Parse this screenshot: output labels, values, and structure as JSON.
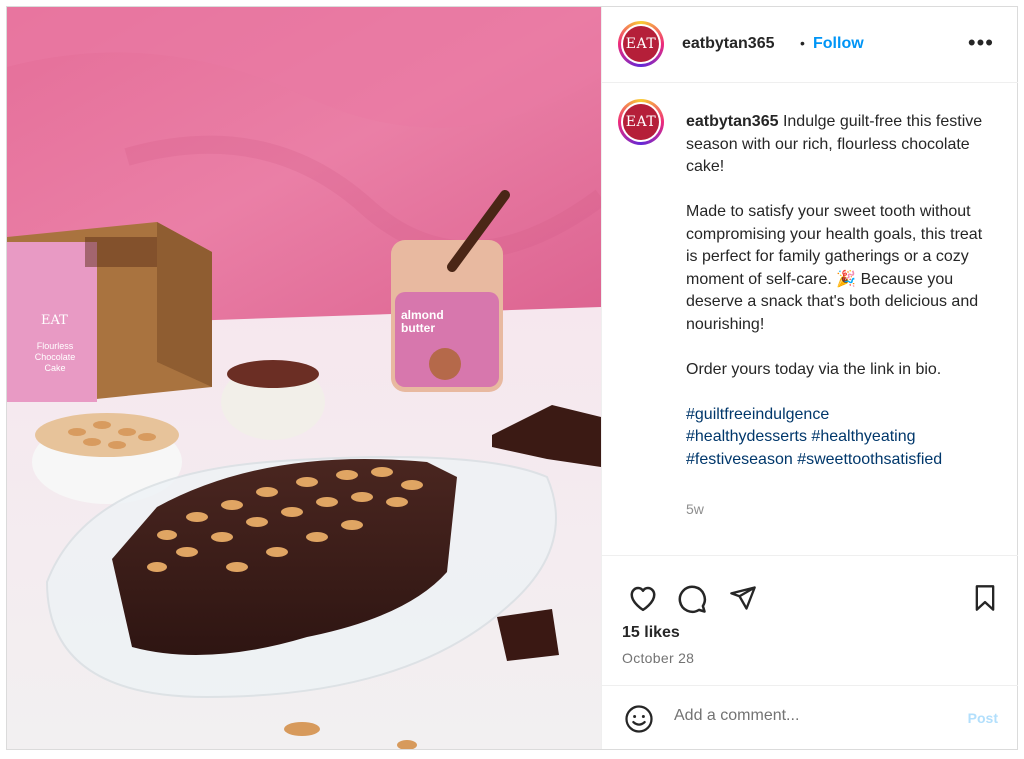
{
  "colors": {
    "accent": "#0095f6",
    "hashtag": "#00376b",
    "brand": "#b51f39"
  },
  "post": {
    "avatar_logo_text": "EAT",
    "username": "eatbytan365",
    "separator": "•",
    "follow_label": "Follow",
    "more_icon": "more-options-icon",
    "caption": {
      "line1": "Indulge guilt-free this festive season with our rich, flourless chocolate cake!",
      "para2": "Made to satisfy your sweet tooth without compromising your health goals, this treat is perfect for family gatherings or a cozy moment of self-care. 🎉 Because you deserve a snack that's both delicious and nourishing!",
      "para3": "Order yours today via the link in bio.",
      "hashtags": [
        "#guiltfreeindulgence",
        "#healthydesserts",
        "#healthyeating",
        "#festiveseason",
        "#sweettoothsatisfied"
      ]
    },
    "time_ago": "5w",
    "likes": "15 likes",
    "date": "October 28",
    "comment_placeholder": "Add a comment...",
    "post_label": "Post"
  },
  "photo": {
    "box_brand": "EAT",
    "box_label": "Flourless Chocolate Cake",
    "jar_label": "almond butter"
  }
}
